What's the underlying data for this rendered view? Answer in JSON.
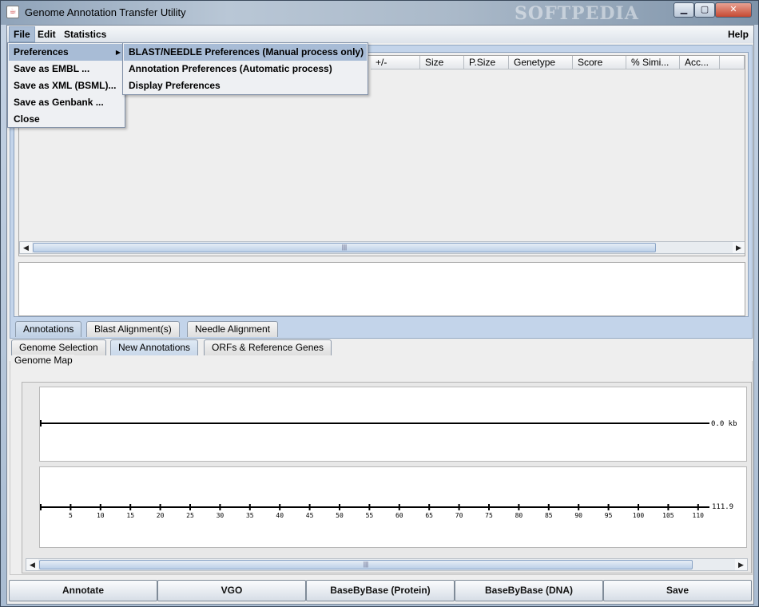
{
  "window": {
    "title": "Genome Annotation Transfer Utility",
    "watermark": "SOFTPEDIA",
    "min_label": "▁",
    "max_label": "▢",
    "close_label": "✕"
  },
  "menubar": {
    "file": "File",
    "edit": "Edit",
    "statistics": "Statistics",
    "help": "Help"
  },
  "file_menu": {
    "items": [
      "Preferences",
      "Save as EMBL ...",
      "Save as XML (BSML)...",
      "Save as Genbank ...",
      "Close"
    ]
  },
  "preferences_submenu": {
    "items": [
      "BLAST/NEEDLE Preferences (Manual process only)",
      "Annotation Preferences (Automatic process)",
      "Display Preferences"
    ]
  },
  "table": {
    "columns": [
      "+/-",
      "Size",
      "P.Size",
      "Genetype",
      "Score",
      "% Simi...",
      "Acc..."
    ]
  },
  "upper_tabs": [
    "Annotations",
    "Blast Alignment(s)",
    "Needle Alignment"
  ],
  "lower_tabs": [
    "Genome Selection",
    "New Annotations",
    "ORFs & Reference Genes"
  ],
  "genome_map": {
    "title": "Genome Map",
    "track1_end_label": "0.0 kb",
    "track2_end_label": "111.9",
    "ticks": [
      "5",
      "10",
      "15",
      "20",
      "25",
      "30",
      "35",
      "40",
      "45",
      "50",
      "55",
      "60",
      "65",
      "70",
      "75",
      "80",
      "85",
      "90",
      "95",
      "100",
      "105",
      "110"
    ]
  },
  "buttons": [
    "Annotate",
    "VGO",
    "BaseByBase (Protein)",
    "BaseByBase (DNA)",
    "Save"
  ]
}
